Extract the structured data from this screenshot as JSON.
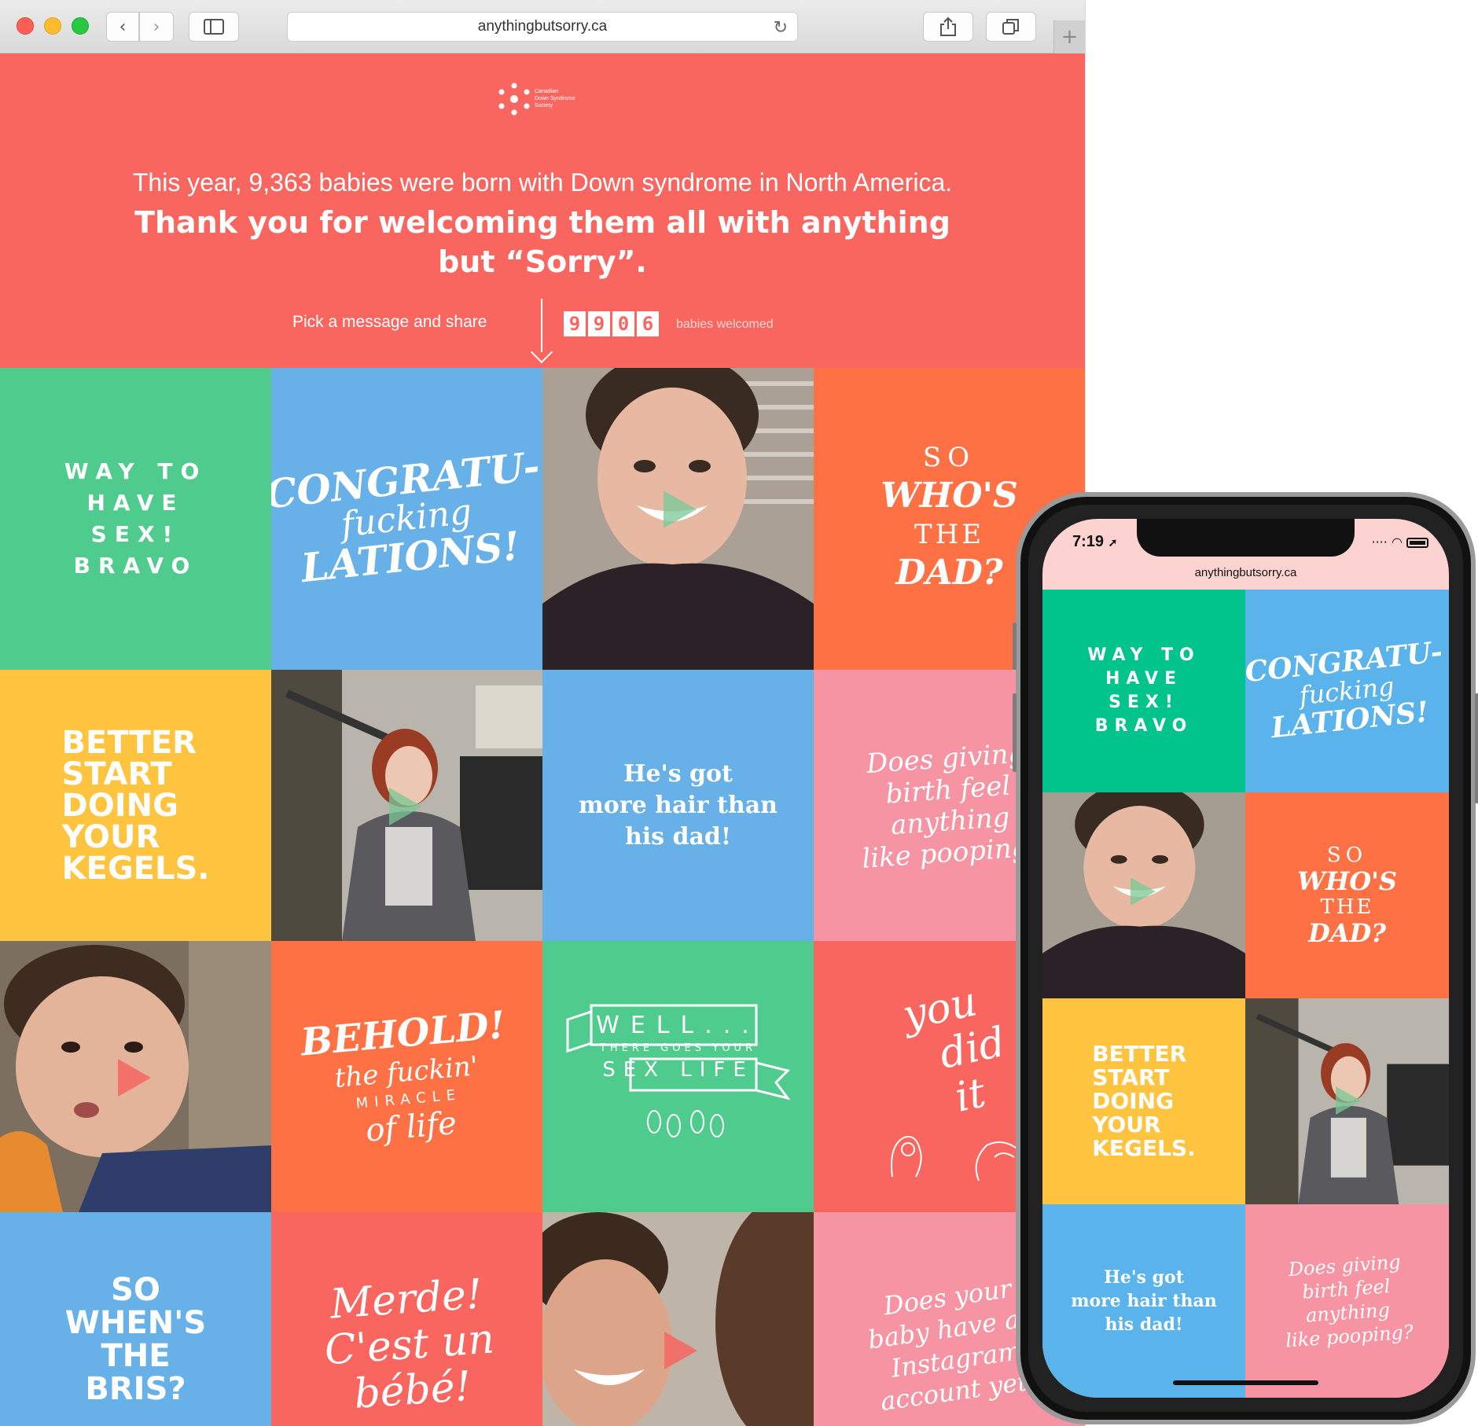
{
  "browser": {
    "url": "anythingbutsorry.ca",
    "icons": [
      "back-icon",
      "forward-icon",
      "sidebar-icon",
      "reload-icon",
      "share-icon",
      "tabs-icon",
      "new-tab-icon"
    ]
  },
  "hero": {
    "logo_text": [
      "Canadian",
      "Down Syndrome",
      "Society"
    ],
    "subtitle": "This year, 9,363 babies were born with Down syndrome in North America.",
    "title": "Thank you for welcoming them all with anything but “Sorry”.",
    "pick_label": "Pick a message and share",
    "counter_digits": [
      "9",
      "9",
      "0",
      "6"
    ],
    "counter_label": "babies welcomed",
    "bg_color": "#f96660"
  },
  "tiles": {
    "way_to_have_sex": [
      "WAY TO",
      "HAVE",
      "SEX!",
      "BRAVO"
    ],
    "congrats": [
      "CONGRATU-",
      "fucking",
      "LATIONS!"
    ],
    "whos_the_dad": [
      "SO",
      "WHO'S",
      "THE",
      "DAD?"
    ],
    "kegels": [
      "BETTER",
      "START",
      "DOING",
      "YOUR",
      "KEGELS."
    ],
    "more_hair": [
      "He's got",
      "more hair than",
      "his dad!"
    ],
    "giving_birth": [
      "Does giving",
      "birth feel",
      "anything",
      "like pooping?"
    ],
    "behold": [
      "BEHOLD!",
      "the fuckin'",
      "MIRACLE",
      "of life"
    ],
    "well_sex_life": [
      "WELL...",
      "THERE GOES YOUR",
      "SEX LIFE"
    ],
    "you_did_it": [
      "you",
      "did",
      "it"
    ],
    "bris": [
      "SO",
      "WHEN'S",
      "THE",
      "BRIS?"
    ],
    "merde": [
      "Merde!",
      "C'est un",
      "bébé!"
    ],
    "instagram": [
      "Does your",
      "baby have an",
      "Instagram",
      "account yet?"
    ]
  },
  "phone": {
    "time": "7:19",
    "url": "anythingbutsorry.ca",
    "status_icons": [
      "location-icon",
      "signal-icon",
      "wifi-icon",
      "battery-icon"
    ]
  },
  "colors": {
    "green": "#4ecb8d",
    "blue": "#68b1e8",
    "orange": "#fd7145",
    "yellow": "#fec33f",
    "pink": "#f794a4",
    "coral": "#f96660",
    "phone_green": "#00c48b",
    "phone_blue": "#5bb3eb"
  }
}
